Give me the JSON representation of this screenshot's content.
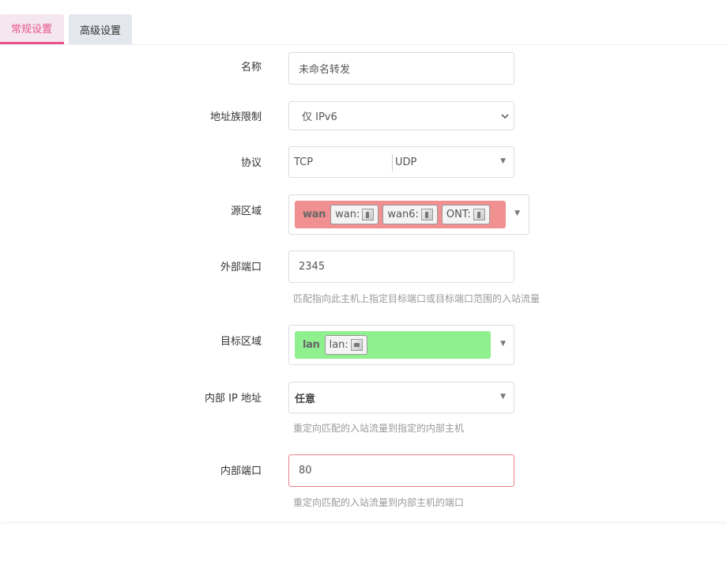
{
  "tabs": [
    {
      "label": "常规设置",
      "active": true
    },
    {
      "label": "高级设置",
      "active": false
    }
  ],
  "form": {
    "name": {
      "label": "名称",
      "value": "未命名转发"
    },
    "family": {
      "label": "地址族限制",
      "value": "仅 IPv6"
    },
    "protocol": {
      "label": "协议",
      "values": [
        "TCP",
        "UDP"
      ]
    },
    "src_zone": {
      "label": "源区域",
      "zone": "wan",
      "color": "#f09090",
      "devices": [
        "wan:",
        "wan6:",
        "ONT:"
      ]
    },
    "ext_port": {
      "label": "外部端口",
      "value": "2345",
      "hint": "匹配指向此主机上指定目标端口或目标端口范围的入站流量"
    },
    "dest_zone": {
      "label": "目标区域",
      "zone": "lan",
      "color": "#90f090",
      "devices": [
        "lan:"
      ]
    },
    "int_ip": {
      "label": "内部 IP 地址",
      "value": "任意",
      "hint": "重定向匹配的入站流量到指定的内部主机"
    },
    "int_port": {
      "label": "内部端口",
      "value": "80",
      "hint": "重定向匹配的入站流量到内部主机的端口"
    }
  },
  "colors": {
    "accent": "#e8558b",
    "error_border": "#e8808f"
  }
}
